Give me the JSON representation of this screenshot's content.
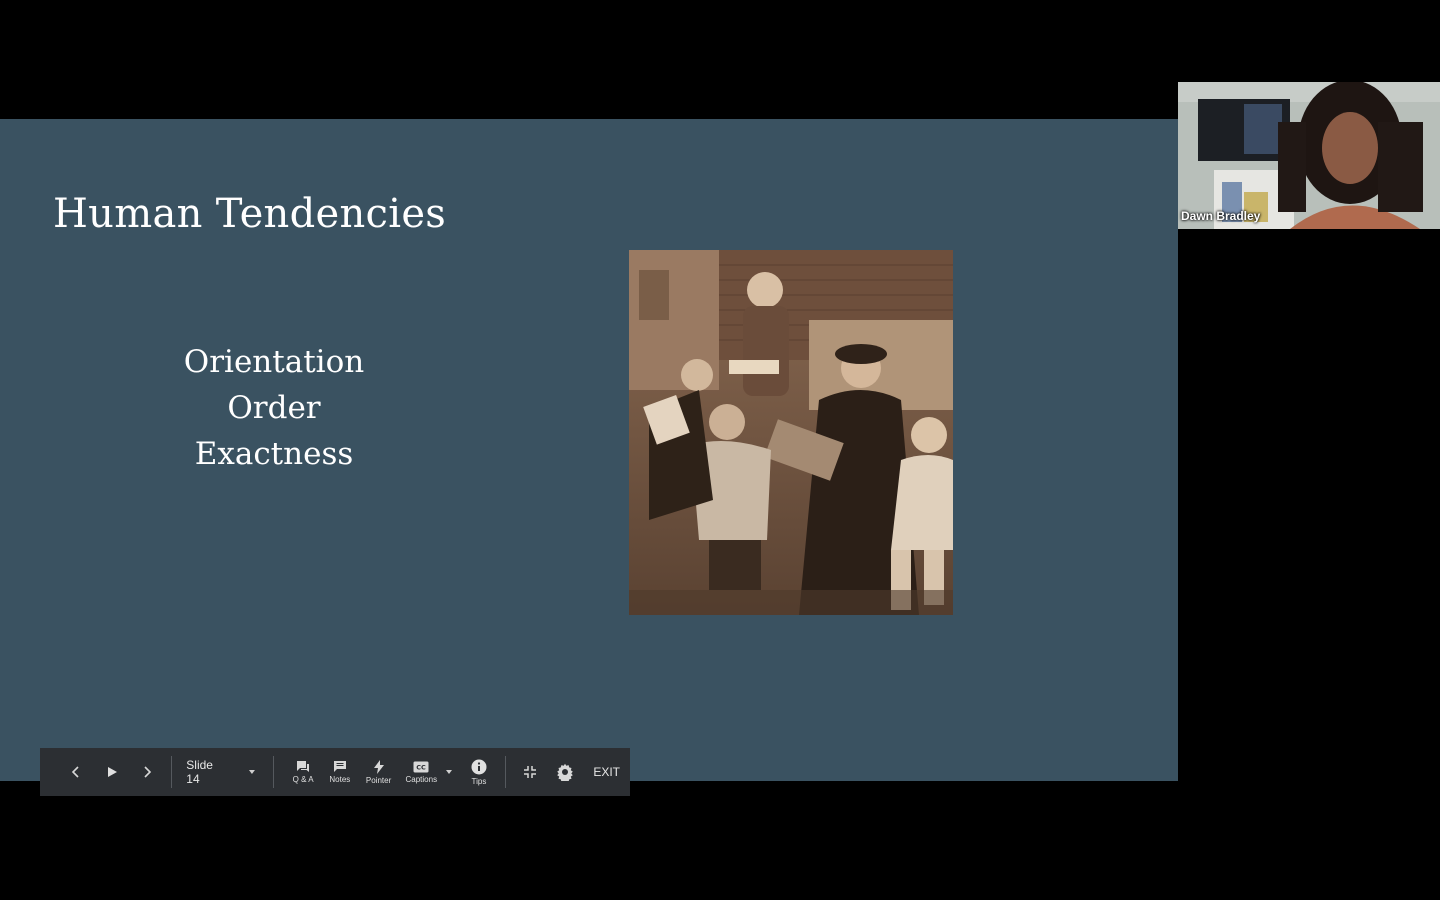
{
  "slide": {
    "title": "Human Tendencies",
    "bullets": [
      "Orientation",
      "Order",
      "Exactness"
    ],
    "background_color": "#3a5261"
  },
  "participant": {
    "name": "Dawn Bradley"
  },
  "toolbar": {
    "slide_selector": "Slide 14",
    "qa_label": "Q & A",
    "notes_label": "Notes",
    "pointer_label": "Pointer",
    "captions_label": "Captions",
    "tips_label": "Tips",
    "exit_label": "EXIT"
  },
  "icons": {
    "prev": "chevron-left-icon",
    "play": "play-icon",
    "next": "chevron-right-icon",
    "slide_dropdown": "caret-down-icon",
    "qa": "chat-icon",
    "notes": "notes-icon",
    "pointer": "lightning-icon",
    "captions": "cc-icon",
    "captions_dropdown": "caret-down-icon",
    "tips": "info-icon",
    "exit_fullscreen": "exit-fullscreen-icon",
    "settings": "gear-icon"
  }
}
